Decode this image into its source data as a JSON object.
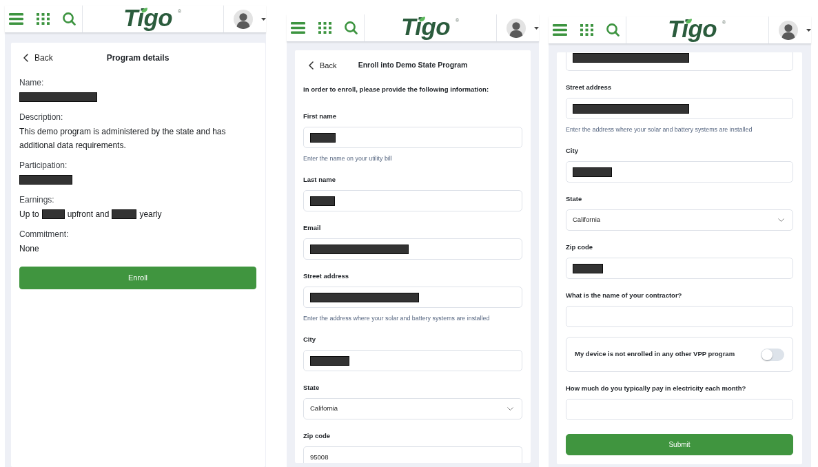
{
  "screens": [
    {
      "kind": "details",
      "header": {
        "logo": {
          "name": "Tigo",
          "mark": "®"
        }
      },
      "back": "Back",
      "title": "Program details",
      "details": [
        {
          "label": "Name:",
          "value": [
            {
              "kind": "redacted"
            }
          ]
        },
        {
          "label": "Description:",
          "value": [
            {
              "kind": "text",
              "text": "This demo program is administered by the state and has additional data requirements."
            }
          ]
        },
        {
          "label": "Participation:",
          "value": [
            {
              "kind": "redacted"
            }
          ]
        },
        {
          "label": "Earnings:",
          "value": [
            {
              "kind": "text",
              "text": "Up to"
            },
            {
              "kind": "redacted"
            },
            {
              "kind": "text",
              "text": "upfront and"
            },
            {
              "kind": "redacted"
            },
            {
              "kind": "text",
              "text": "yearly"
            }
          ]
        },
        {
          "label": "Commitment:",
          "value": [
            {
              "kind": "text",
              "text": "None"
            }
          ]
        }
      ],
      "button": "Enroll"
    },
    {
      "kind": "form",
      "header": {
        "logo": {
          "name": "Tigo",
          "mark": "®"
        }
      },
      "back": "Back",
      "title": "Enroll into Demo State Program",
      "intro": "In order to enroll, please provide the following information:",
      "fields": [
        {
          "kind": "text",
          "label": "First name",
          "value": [
            {
              "kind": "redacted"
            }
          ],
          "help": "Enter the name on your utility bill",
          "clipped": false
        },
        {
          "kind": "text",
          "label": "Last name",
          "value": [
            {
              "kind": "redacted"
            }
          ],
          "clipped": false
        },
        {
          "kind": "text",
          "label": "Email",
          "value": [
            {
              "kind": "redacted"
            }
          ],
          "clipped": false
        },
        {
          "kind": "text",
          "label": "Street address",
          "value": [
            {
              "kind": "redacted"
            }
          ],
          "help": "Enter the address where your solar and battery systems are installed",
          "clipped": false
        },
        {
          "kind": "text",
          "label": "City",
          "value": [
            {
              "kind": "redacted"
            }
          ],
          "clipped": false
        },
        {
          "kind": "select",
          "label": "State",
          "value": "California",
          "clipped": false
        },
        {
          "kind": "text",
          "label": "Zip code",
          "value": [
            {
              "kind": "text",
              "text": "95008"
            }
          ],
          "clipped": true
        }
      ]
    },
    {
      "kind": "form",
      "header": {
        "logo": {
          "name": "Tigo",
          "mark": "®"
        }
      },
      "fields": [
        {
          "kind": "text",
          "value": [
            {
              "kind": "redacted"
            }
          ],
          "clipped": true
        },
        {
          "kind": "text",
          "label": "Street address",
          "value": [
            {
              "kind": "redacted"
            }
          ],
          "help": "Enter the address where your solar and battery systems are installed",
          "clipped": false
        },
        {
          "kind": "text",
          "label": "City",
          "value": [
            {
              "kind": "redacted"
            }
          ],
          "clipped": false
        },
        {
          "kind": "select",
          "label": "State",
          "value": "California",
          "clipped": false
        },
        {
          "kind": "text",
          "label": "Zip code",
          "value": [
            {
              "kind": "redacted"
            }
          ],
          "clipped": false
        },
        {
          "kind": "text",
          "label": "What is the name of your contractor?",
          "clipped": false
        },
        {
          "kind": "toggle",
          "label": "My device is not enrolled in any other VPP program",
          "on": false,
          "clipped": false
        },
        {
          "kind": "text",
          "label": "How much do you typically pay in electricity each month?",
          "clipped": false
        }
      ],
      "button": "Submit"
    }
  ]
}
